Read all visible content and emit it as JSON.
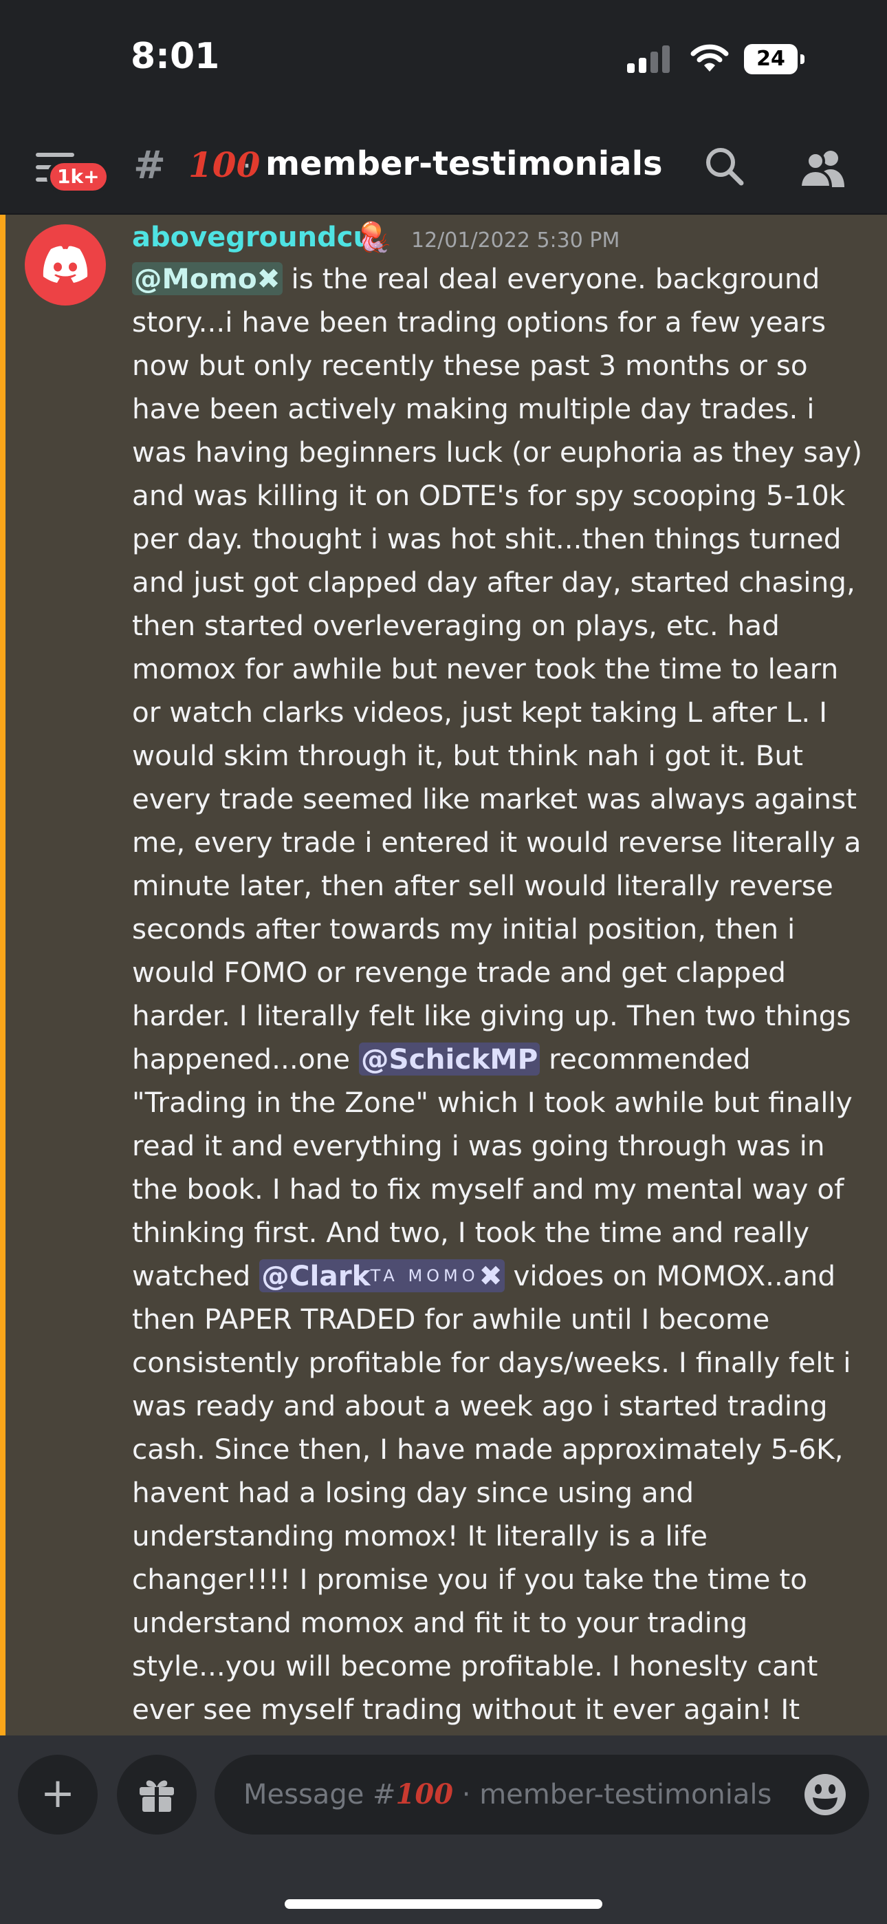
{
  "status_bar": {
    "time": "8:01",
    "battery": "24"
  },
  "header": {
    "unread_badge": "1k+",
    "channel_prefix": "#",
    "channel_emoji": "100",
    "separator": "·",
    "channel_name": "member-testimonials"
  },
  "message": {
    "author": "abovegroundcu",
    "author_badge": "🪼",
    "timestamp": "12/01/2022 5:30 PM",
    "mention_1": "@Momo✖",
    "text_1": " is the real deal everyone.  background story...i have been trading options for a few years now but only recently these past 3 months or so have been actively making multiple day trades.  i was having beginners luck (or euphoria as they say) and was killing it on ODTE's for spy scooping 5-10k per day.  thought i was hot shit...then things turned and just got clapped day after day, started chasing, then started overleveraging on plays, etc.  had momox for awhile but never took the time to learn or watch clarks videos, just kept taking L after L.  I would skim through it, but think nah i got it.  But every trade seemed like market was always against me, every trade i entered it would reverse literally a minute later, then after sell would literally reverse seconds after towards my initial position, then i would FOMO or revenge trade and get clapped harder.  I literally felt like giving up.  Then two things happened...one ",
    "mention_2": "@SchickMP",
    "text_2": " recommended \"Trading in the Zone\" which I took awhile but finally read it and everything i was going through was in the book.  I had to fix myself and my mental way of thinking first.  And two, I took the time and really watched ",
    "mention_3": "@Clark",
    "mention_3_sup": "TA MOMO",
    "mention_3_x": "✖",
    "text_3": " vidoes on MOMOX..and then PAPER TRADED for awhile until I become consistently profitable for days/weeks.  I finally felt i was ready and about a week ago i started trading cash.  Since then, I have made approximately 5-6K, havent had a losing day since using and understanding momox!  It literally is a life changer!!!!  I promise you if you take the time to understand momox and fit it to your trading style...you will become profitable.  I honeslty cant ever see myself trading without it ever again!  It simple!!!! Thanks CLARK! and all the other"
  },
  "composer": {
    "placeholder_prefix": "Message #",
    "placeholder_emoji": "100",
    "placeholder_rest": " · member-testimonials"
  },
  "colors": {
    "author": "#4fe3e3",
    "mention_bar": "#faa61a",
    "avatar": "#ed4245",
    "header_bg": "#202225",
    "message_bg": "#49443a"
  }
}
